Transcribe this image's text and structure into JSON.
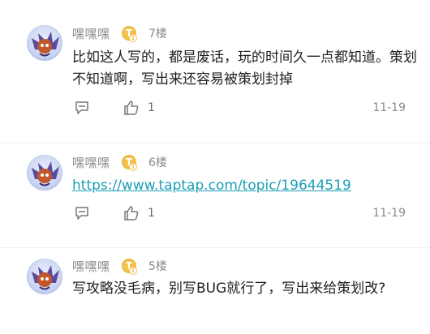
{
  "posts": [
    {
      "user": "嘿嘿嘿",
      "level_badge": "T",
      "level_sub": "1",
      "floor": "7楼",
      "content": "比如这人写的，都是废话，玩的时间久一点都知道。策划不知道啊，写出来还容易被策划封掉",
      "likes": "1",
      "date": "11-19"
    },
    {
      "user": "嘿嘿嘿",
      "level_badge": "T",
      "level_sub": "1",
      "floor": "6楼",
      "content": "https://www.taptap.com/topic/19644519",
      "likes": "1",
      "date": "11-19"
    },
    {
      "user": "嘿嘿嘿",
      "level_badge": "T",
      "level_sub": "1",
      "floor": "5楼",
      "content": "写攻略没毛病，别写BUG就行了，写出来给策划改?"
    }
  ],
  "icons": {
    "comment": "comment-icon",
    "like": "thumbs-up-icon"
  },
  "colors": {
    "link": "#1c9fb5",
    "badge": "#f2c14a",
    "meta_text": "#8a8a8a"
  }
}
